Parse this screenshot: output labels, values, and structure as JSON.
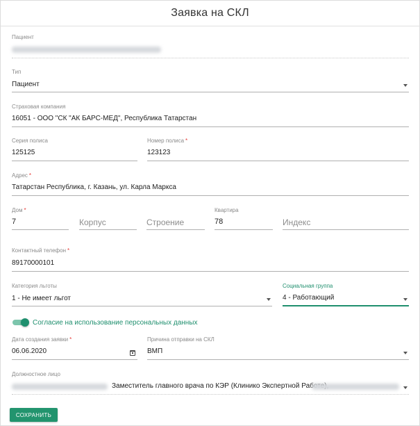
{
  "dialog": {
    "title": "Заявка на СКЛ"
  },
  "patient": {
    "label": "Пациент"
  },
  "type": {
    "label": "Тип",
    "value": "Пациент"
  },
  "insurer": {
    "label": "Страховая компания",
    "value": "16051 - ООО \"СК \"АК БАРС-МЕД\", Республика Татарстан"
  },
  "policy_series": {
    "label": "Серия полиса",
    "value": "125125"
  },
  "policy_number": {
    "label": "Номер полиса",
    "required": "*",
    "value": "123123"
  },
  "address": {
    "label": "Адрес",
    "required": "*",
    "value": "Татарстан Республика, г. Казань, ул. Карла Маркса"
  },
  "house": {
    "label": "Дом",
    "required": "*",
    "value": "7"
  },
  "korpus": {
    "placeholder": "Корпус"
  },
  "stroenie": {
    "placeholder": "Строение"
  },
  "apartment": {
    "label": "Квартира",
    "value": "78"
  },
  "index": {
    "placeholder": "Индекс"
  },
  "phone": {
    "label": "Контактный телефон",
    "required": "*",
    "value": "89170000101"
  },
  "benefit": {
    "label": "Категория льготы",
    "value": "1 - Не имеет льгот"
  },
  "social_group": {
    "label": "Социальная группа",
    "value": "4 - Работающий"
  },
  "consent": {
    "label": "Согласие на использование персональных данных",
    "checked": true
  },
  "created_date": {
    "label": "Дата создания заявки",
    "required": "*",
    "value": "06.06.2020"
  },
  "reason": {
    "label": "Причина отправки на СКЛ",
    "value": "ВМП"
  },
  "official": {
    "label": "Должностное лицо",
    "value": "Заместитель главного врача по КЭР (Клинико Экспертной Работе),"
  },
  "actions": {
    "save_label": "СОХРАНИТЬ"
  },
  "colors": {
    "accent": "#22946e",
    "required": "#e53935"
  }
}
